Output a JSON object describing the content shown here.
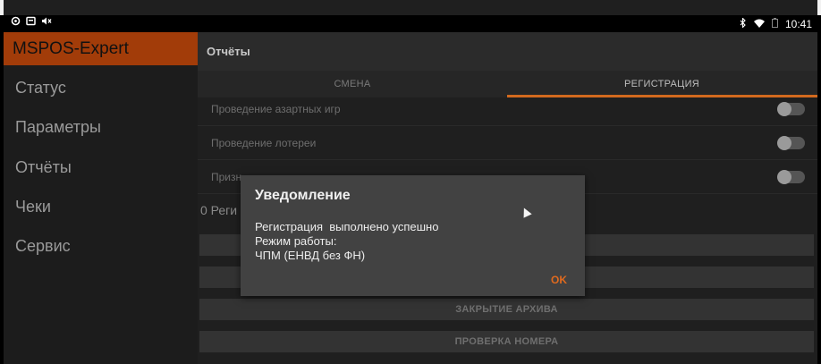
{
  "window": {
    "controls": [
      "popout-icon",
      "close-icon"
    ]
  },
  "statusbar": {
    "left_icons": [
      "circle-icon",
      "screen-icon",
      "mute-icon"
    ],
    "right_icons": [
      "bluetooth-icon",
      "wifi-icon",
      "battery-icon"
    ],
    "time": "10:41"
  },
  "sidebar": {
    "title": "MSPOS-Expert",
    "items": [
      "Статус",
      "Параметры",
      "Отчёты",
      "Чеки",
      "Сервис"
    ]
  },
  "header": {
    "title": "Отчёты"
  },
  "tabs": [
    {
      "label": "СМЕНА",
      "active": false
    },
    {
      "label": "РЕГИСТРАЦИЯ",
      "active": true
    }
  ],
  "settings": [
    {
      "label": "Проведение азартных игр",
      "on": false
    },
    {
      "label": "Проведение лотереи",
      "on": false
    },
    {
      "label": "Призн",
      "on": false
    }
  ],
  "counter_text": "0 Реги",
  "buttons": [
    "",
    "",
    "ЗАКРЫТИЕ АРХИВА",
    "ПРОВЕРКА НОМЕРА"
  ],
  "dialog": {
    "title": "Уведомление",
    "message": "Регистрация  выполнено успешно\nРежим работы:\nЧПМ (ЕНВД без ФН)",
    "ok_label": "OK"
  },
  "colors": {
    "accent": "#a23c09",
    "tab_indicator": "#d2691e",
    "ok_button": "#e06a1e"
  }
}
